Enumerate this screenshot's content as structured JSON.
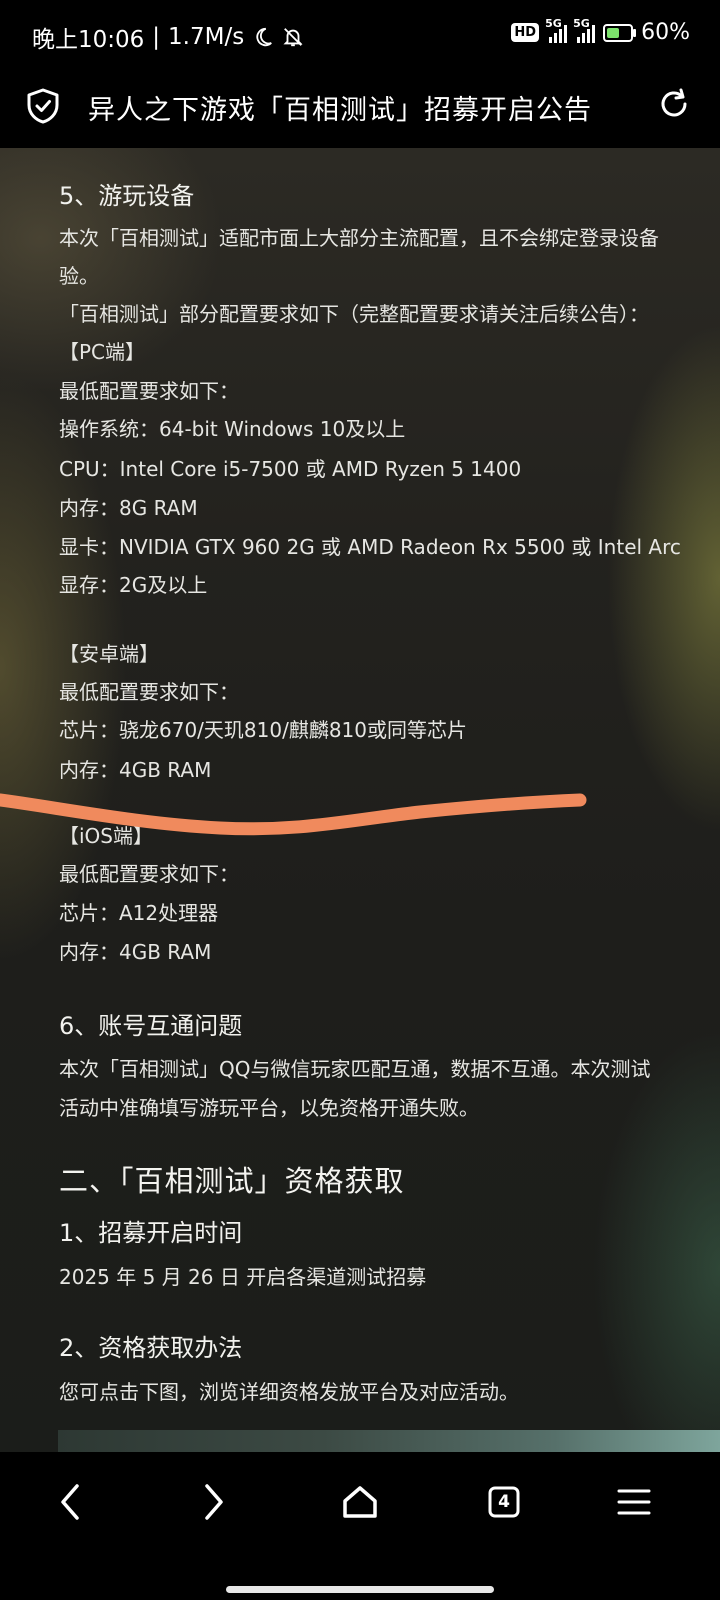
{
  "status_bar": {
    "time": "晚上10:06",
    "speed": "1.7M/s",
    "hd_label": "HD",
    "network1": "5G",
    "network2": "5G",
    "battery": "60%"
  },
  "title_bar": {
    "title": "异人之下游戏「百相测试」招募开启公告"
  },
  "article": {
    "s5_heading": "5、游玩设备",
    "s5_para1_line1": "本次「百相测试」适配市面上大部分主流配置，且不会绑定登录设备",
    "s5_para1_line2": "验。",
    "s5_para2": "「百相测试」部分配置要求如下（完整配置要求请关注后续公告）：",
    "pc_label": "【PC端】",
    "pc_min": "最低配置要求如下：",
    "pc_os": "操作系统：64-bit Windows 10及以上",
    "pc_cpu": "CPU：Intel Core i5-7500 或 AMD Ryzen 5 1400",
    "pc_ram": "内存：8G RAM",
    "pc_gpu": "显卡：NVIDIA GTX 960 2G 或 AMD Radeon Rx 5500 或 Intel Arc",
    "pc_vram": "显存：2G及以上",
    "android_label": "【安卓端】",
    "android_min": "最低配置要求如下：",
    "android_chip": "芯片：骁龙670/天玑810/麒麟810或同等芯片",
    "android_ram": "内存：4GB RAM",
    "ios_label": "【iOS端】",
    "ios_min": "最低配置要求如下：",
    "ios_chip": "芯片：A12处理器",
    "ios_ram": "内存：4GB RAM",
    "s6_heading": "6、账号互通问题",
    "s6_line1": "本次「百相测试」QQ与微信玩家匹配互通，数据不互通。本次测试",
    "s6_line2": "活动中准确填写游玩平台，以免资格开通失败。",
    "part2_heading": "二、「百相测试」资格获取",
    "p2_s1_heading": "1、招募开启时间",
    "p2_s1_text": "2025 年 5 月 26 日 开启各渠道测试招募",
    "p2_s2_heading": "2、资格获取办法",
    "p2_s2_text": "您可点击下图，浏览详细资格发放平台及对应活动。"
  },
  "nav_bar": {
    "tabs_count": "4"
  },
  "colors": {
    "annotation_stroke": "#f08a5d",
    "background": "#000000",
    "text": "#e6e6e2"
  },
  "icons": [
    "moon-icon",
    "mute-bell-icon",
    "signal-icon",
    "battery-icon",
    "shield-check-icon",
    "refresh-icon",
    "back-icon",
    "forward-icon",
    "home-icon",
    "tabs-icon",
    "menu-icon"
  ]
}
